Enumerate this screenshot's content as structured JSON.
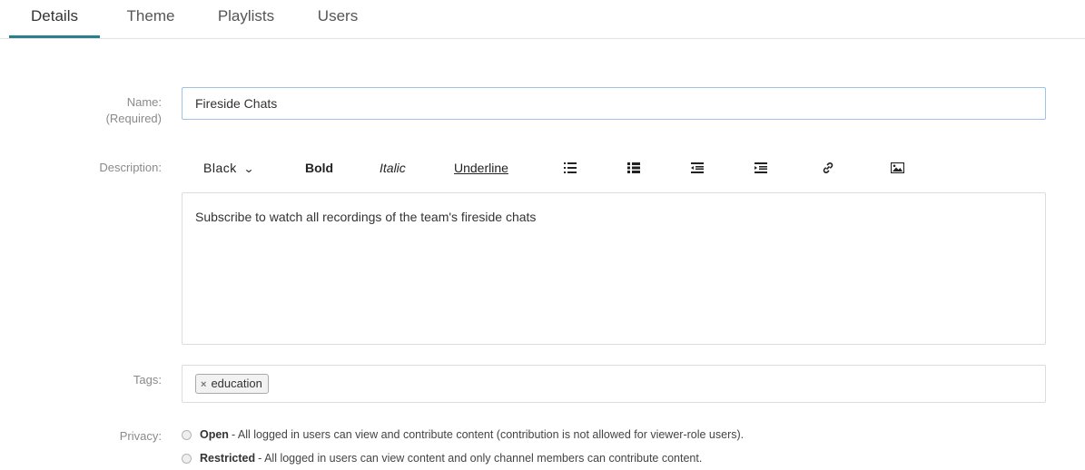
{
  "tabs": [
    {
      "label": "Details",
      "active": true
    },
    {
      "label": "Theme",
      "active": false
    },
    {
      "label": "Playlists",
      "active": false
    },
    {
      "label": "Users",
      "active": false
    }
  ],
  "form": {
    "name_label": "Name:",
    "name_required": "(Required)",
    "name_value": "Fireside Chats",
    "description_label": "Description:",
    "description_text": "Subscribe to watch all recordings of the team's fireside chats",
    "tags_label": "Tags:",
    "tags": [
      "education"
    ],
    "privacy_label": "Privacy:",
    "privacy_options": [
      {
        "title": "Open",
        "description": "- All logged in users can view and contribute content (contribution is not allowed for viewer-role users)."
      },
      {
        "title": "Restricted",
        "description": "- All logged in users can view content and only channel members can contribute content."
      }
    ]
  },
  "toolbar": {
    "color_label": "Black",
    "bold_label": "Bold",
    "italic_label": "Italic",
    "underline_label": "Underline",
    "icons": [
      "ordered-list-icon",
      "unordered-list-icon",
      "outdent-icon",
      "indent-icon",
      "link-icon",
      "image-icon"
    ]
  },
  "colors": {
    "active_tab_underline": "#2a7f8f",
    "name_input_border": "#9fc3e6"
  }
}
